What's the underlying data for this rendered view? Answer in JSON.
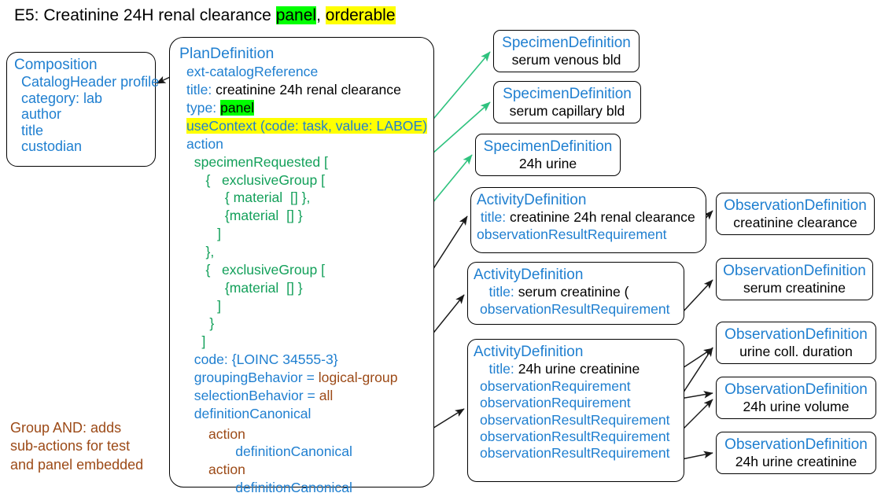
{
  "title": {
    "prefix": "E5: Creatinine 24H renal clearance ",
    "highlight_green": "panel",
    "middle": ", ",
    "highlight_yellow": "orderable"
  },
  "colors": {
    "resource_blue": "#1f7fd0",
    "green_text": "#13a05a",
    "brown_text": "#9c4a17",
    "highlight_green": "#00ff00",
    "highlight_yellow": "#ffff00",
    "arrow_green": "#2ec27e",
    "arrow_black": "#1a1a1a"
  },
  "composition": {
    "header": "Composition",
    "items": [
      "CatalogHeader profile",
      "category: lab",
      "author",
      "title",
      "custodian"
    ]
  },
  "plan_definition": {
    "header": "PlanDefinition",
    "ext": "ext-catalogReference",
    "title_key": "title:",
    "title_value": " creatinine 24h renal clearance",
    "type_key": "type:",
    "type_value": "panel",
    "use_context": "useContext (code: task, value: LABOE)",
    "action": "action",
    "specimen_lines": [
      "  specimenRequested [",
      "     {   exclusiveGroup [",
      "          { material  [] },",
      "          {material  [] }",
      "        ]",
      "     },",
      "     {   exclusiveGroup [",
      "          {material  [] }",
      "        ]",
      "      }",
      "    ]"
    ],
    "code": "  code: {LOINC 34555-3}",
    "grouping_key": "  groupingBehavior = ",
    "grouping_value": "logical-group",
    "selection_key": "  selectionBehavior = ",
    "selection_value": "all",
    "definition_canonical": "  definitionCanonical",
    "sub_action_1": "action",
    "sub_definition_1": "       definitionCanonical",
    "sub_action_2": "action",
    "sub_definition_2": "       definitionCanonical"
  },
  "group_note": [
    "Group AND: adds",
    "sub-actions for test",
    "and panel embedded"
  ],
  "specimen_definitions": [
    {
      "header": "SpecimenDefinition",
      "label": "serum venous bld"
    },
    {
      "header": "SpecimenDefinition",
      "label": "serum capillary bld"
    },
    {
      "header": "SpecimenDefinition",
      "label": "24h urine"
    }
  ],
  "activity_definitions": [
    {
      "header": "ActivityDefinition",
      "title_key": " title:",
      "title_value": " creatinine 24h renal clearance",
      "requirements": [
        "observationResultRequirement"
      ]
    },
    {
      "header": "ActivityDefinition",
      "title_key": "    title:",
      "title_value": " serum creatinine (",
      "requirements": [
        "observationResultRequirement"
      ]
    },
    {
      "header": "ActivityDefinition",
      "title_key": "    title:",
      "title_value": " 24h urine creatinine",
      "requirements": [
        "observationRequirement",
        "observationRequirement",
        "observationResultRequirement",
        "observationResultRequirement",
        "observationResultRequirement"
      ]
    }
  ],
  "observation_definitions": [
    {
      "header": "ObservationDefinition",
      "label": "creatinine clearance"
    },
    {
      "header": "ObservationDefinition",
      "label": "serum creatinine"
    },
    {
      "header": "ObservationDefinition",
      "label": "urine coll. duration"
    },
    {
      "header": "ObservationDefinition",
      "label": "24h urine volume"
    },
    {
      "header": "ObservationDefinition",
      "label": "24h urine creatinine"
    }
  ]
}
